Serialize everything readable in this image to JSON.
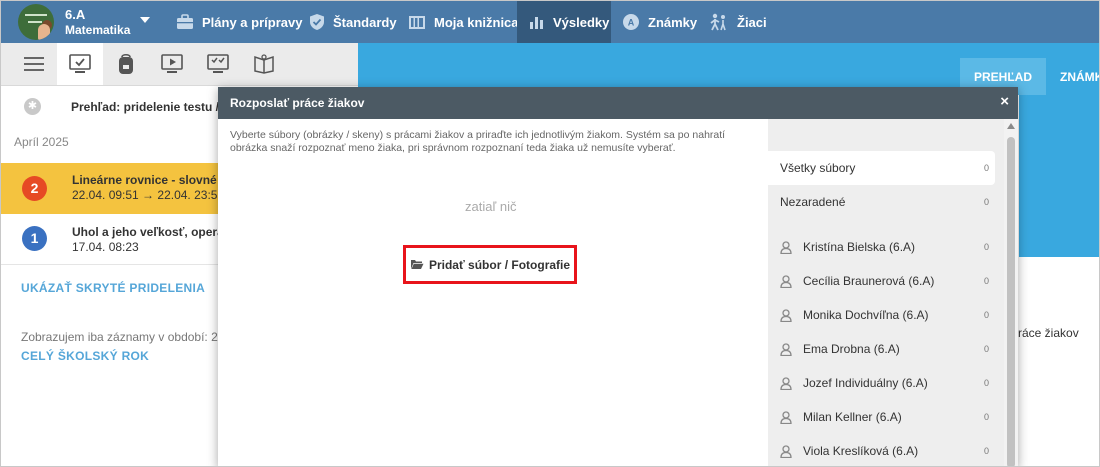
{
  "colors": {
    "topbar": "#4a7aa8",
    "accent": "#39a8df",
    "highlight": "#f4c33f",
    "badge_red": "#e64a24",
    "badge_blue": "#3a71c1",
    "link": "#55a6d8",
    "callout": "#e8141b"
  },
  "header": {
    "class_name": "6.A",
    "subject": "Matematika",
    "nav": [
      {
        "label": "Plány a prípravy",
        "icon": "briefcase-icon"
      },
      {
        "label": "Štandardy",
        "icon": "shield-check-icon"
      },
      {
        "label": "Moja knižnica",
        "icon": "library-icon"
      },
      {
        "label": "Výsledky",
        "icon": "bar-chart-icon",
        "active": true
      },
      {
        "label": "Známky",
        "icon": "grades-icon"
      },
      {
        "label": "Žiaci",
        "icon": "students-icon"
      }
    ]
  },
  "left": {
    "tabs": [
      "menu-icon",
      "monitor-check-icon",
      "backpack-icon",
      "play-icon",
      "test-icon",
      "book-icon"
    ],
    "overview_title": "Prehľad: pridelenie testu / ",
    "month": "Apríl 2025",
    "items": [
      {
        "badge": "2",
        "title": "Lineárne rovnice - slovné",
        "dates": "22.04. 09:51 → 22.04. 23:5"
      },
      {
        "badge": "1",
        "title": "Uhol a jeho veľkosť, opera",
        "dates": "17.04. 08:23"
      }
    ],
    "show_hidden": "UKÁZAŤ SKRYTÉ PRIDELENIA",
    "period_note": "Zobrazujem iba záznamy v období: 2",
    "whole_year": "CELÝ ŠKOLSKÝ ROK"
  },
  "right": {
    "tabs": [
      "PREHĽAD",
      "ZNÁMK"
    ],
    "text": "ráce žiakov"
  },
  "modal": {
    "title": "Rozposlať práce žiakov",
    "close": "×",
    "description": "Vyberte súbory (obrázky / skeny) s prácami žiakov a priraďte ich jednotlivým žiakom. Systém sa po nahratí obrázka snaží rozpoznať meno žiaka, pri správnom rozpoznaní teda žiaka už nemusíte vyberať.",
    "empty": "zatiaľ nič",
    "add_button": "Pridať súbor / Fotografie",
    "files": {
      "all": {
        "label": "Všetky súbory",
        "count": "0"
      },
      "unassigned": {
        "label": "Nezaradené",
        "count": "0"
      },
      "students": [
        {
          "name": "Kristína Bielska (6.A)",
          "count": "0"
        },
        {
          "name": "Cecília Braunerová (6.A)",
          "count": "0"
        },
        {
          "name": "Monika Dochvíľna (6.A)",
          "count": "0"
        },
        {
          "name": "Ema Drobna (6.A)",
          "count": "0"
        },
        {
          "name": "Jozef Individuálny (6.A)",
          "count": "0"
        },
        {
          "name": "Milan Kellner (6.A)",
          "count": "0"
        },
        {
          "name": "Viola Kreslíková (6.A)",
          "count": "0"
        }
      ]
    }
  }
}
